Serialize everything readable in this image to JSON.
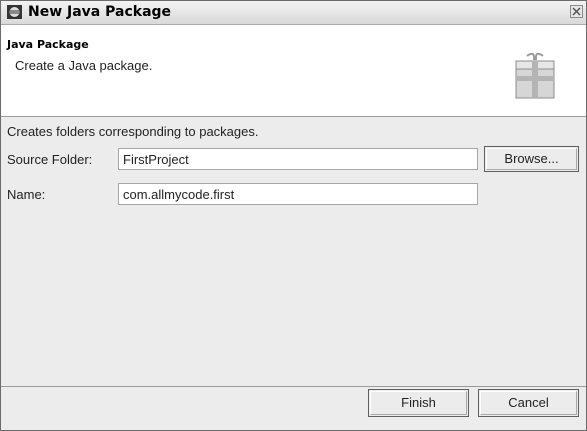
{
  "window": {
    "title": "New Java Package"
  },
  "banner": {
    "title": "Java Package",
    "description": "Create a Java package."
  },
  "form": {
    "hint": "Creates folders corresponding to packages.",
    "source_folder_label": "Source Folder:",
    "source_folder_value": "FirstProject",
    "browse_label": "Browse...",
    "name_label": "Name:",
    "name_value": "com.allmycode.first"
  },
  "buttons": {
    "finish": "Finish",
    "cancel": "Cancel"
  },
  "icons": {
    "app": "eclipse-icon",
    "banner": "package-icon",
    "close": "close-icon"
  }
}
